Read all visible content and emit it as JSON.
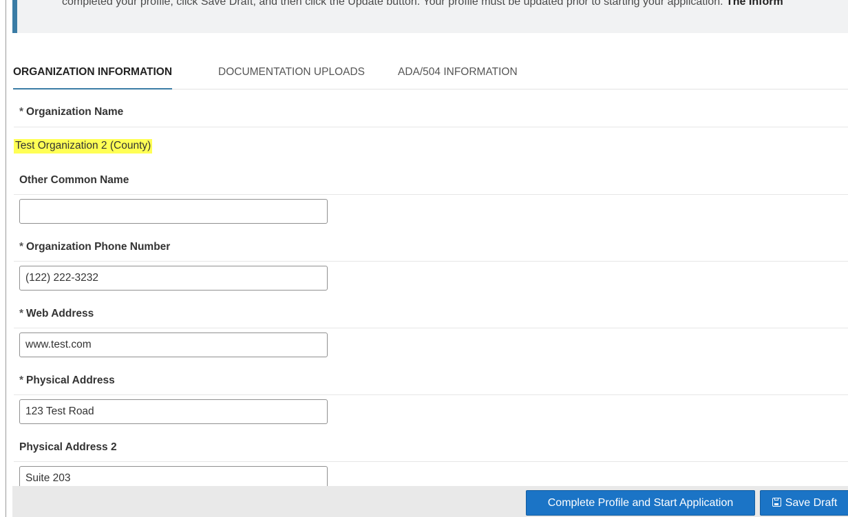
{
  "notice": {
    "text": "completed your profile, click Save Draft, and then click the Update button. Your profile must be updated prior to starting your application.",
    "bold_text": "The Inform"
  },
  "tabs": [
    {
      "label": "ORGANIZATION INFORMATION",
      "active": true
    },
    {
      "label": "DOCUMENTATION UPLOADS",
      "active": false
    },
    {
      "label": "ADA/504 INFORMATION",
      "active": false
    }
  ],
  "required_marker": "*",
  "form": {
    "organization_name": {
      "label": "Organization Name",
      "value": "Test Organization 2 (County)"
    },
    "other_common_name": {
      "label": "Other Common Name",
      "value": ""
    },
    "phone": {
      "label": "Organization Phone Number",
      "value": "(122) 222-3232"
    },
    "web_address": {
      "label": "Web Address",
      "value": "www.test.com"
    },
    "physical_address": {
      "label": "Physical Address",
      "value": "123 Test Road"
    },
    "physical_address_2": {
      "label": "Physical Address 2",
      "value": "Suite 203"
    }
  },
  "footer": {
    "complete_label": "Complete Profile and Start Application",
    "save_label": "Save Draft"
  },
  "colors": {
    "accent": "#3a7ca5",
    "button": "#1b74c6",
    "highlight": "#ffff55"
  }
}
